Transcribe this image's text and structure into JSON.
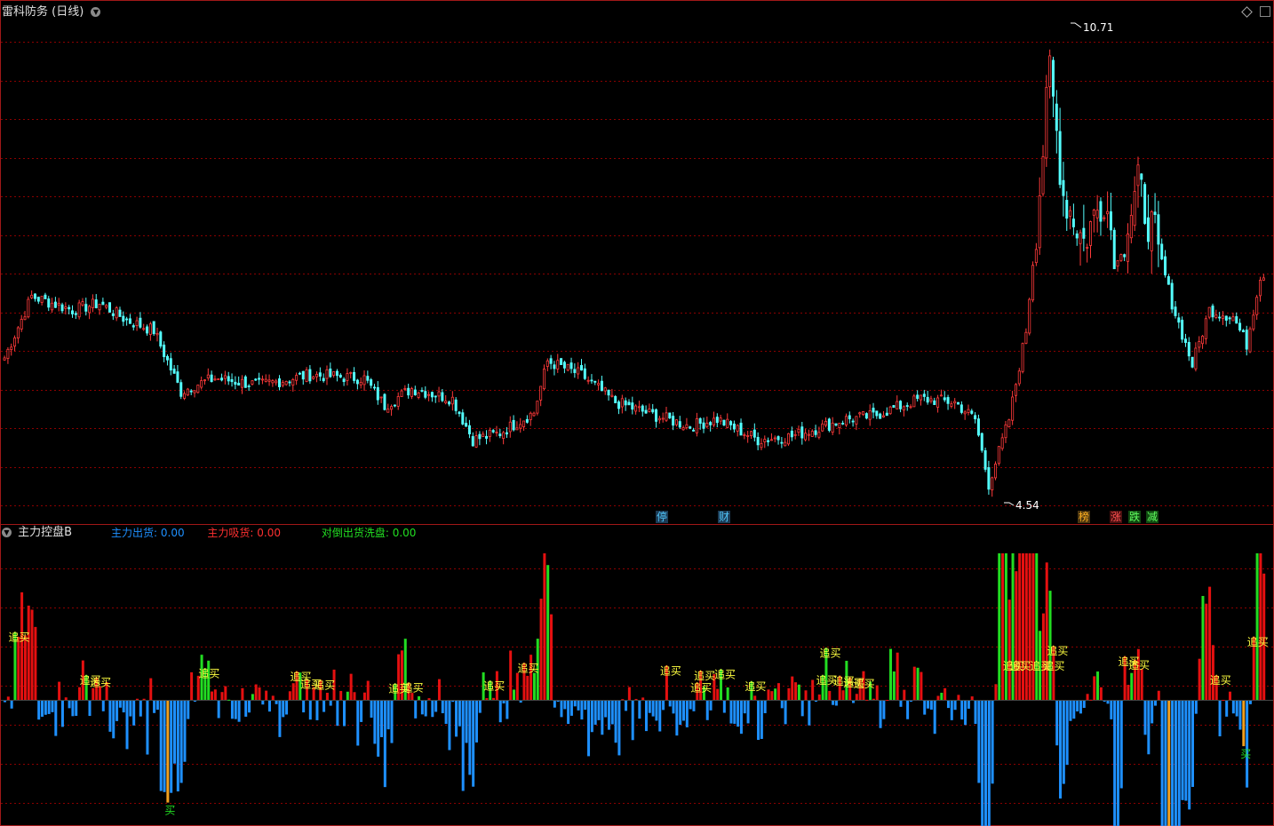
{
  "header": {
    "title": "雷科防务",
    "period": "(日线)"
  },
  "indicator": {
    "name": "主力控盘B",
    "items": [
      {
        "label": "主力出货:",
        "value": "0.00",
        "color": "#1e90ff"
      },
      {
        "label": "主力吸货:",
        "value": "0.00",
        "color": "#ff3030"
      },
      {
        "label": "对倒出货洗盘:",
        "value": "0.00",
        "color": "#22dd22"
      }
    ]
  },
  "events": [
    {
      "label": "停",
      "bg": "#1c3b55",
      "fg": "#4fc3f7"
    },
    {
      "label": "财",
      "bg": "#1c3b55",
      "fg": "#4fc3f7"
    },
    {
      "label": "榜",
      "bg": "#4a3510",
      "fg": "#ffb020"
    },
    {
      "label": "涨",
      "bg": "#4a1010",
      "fg": "#ff5050"
    },
    {
      "label": "跌",
      "bg": "#104a10",
      "fg": "#60ff60"
    },
    {
      "label": "减",
      "bg": "#104a10",
      "fg": "#60ff60"
    }
  ],
  "colors": {
    "up": "#ff3a3a",
    "down": "#54ffff",
    "grid": "#8b0000",
    "frame": "#a01818",
    "outflow": "#1e90ff",
    "inflow": "#e51010",
    "wash": "#22dd22",
    "buy_zone": "#f0a020",
    "signal_text": "#ffff40"
  },
  "chart_data": [
    {
      "type": "candlestick",
      "title": "雷科防务",
      "price_high_label": "10.71",
      "price_low_label": "4.54",
      "high": 10.71,
      "low": 4.54,
      "ylim": [
        4.2,
        11.3
      ],
      "anchors": [
        [
          0,
          6.4
        ],
        [
          8,
          7.3
        ],
        [
          20,
          7.1
        ],
        [
          28,
          7.2
        ],
        [
          36,
          6.95
        ],
        [
          44,
          6.8
        ],
        [
          52,
          5.9
        ],
        [
          56,
          6.0
        ],
        [
          62,
          6.1
        ],
        [
          75,
          6.0
        ],
        [
          90,
          6.15
        ],
        [
          106,
          6.1
        ],
        [
          112,
          5.7
        ],
        [
          120,
          5.95
        ],
        [
          132,
          5.8
        ],
        [
          138,
          5.2
        ],
        [
          146,
          5.3
        ],
        [
          156,
          5.6
        ],
        [
          160,
          6.35
        ],
        [
          170,
          6.15
        ],
        [
          180,
          5.75
        ],
        [
          192,
          5.55
        ],
        [
          202,
          5.4
        ],
        [
          210,
          5.5
        ],
        [
          222,
          5.2
        ],
        [
          232,
          5.25
        ],
        [
          248,
          5.5
        ],
        [
          256,
          5.55
        ],
        [
          270,
          5.8
        ],
        [
          280,
          5.75
        ],
        [
          286,
          5.5
        ],
        [
          290,
          4.55
        ],
        [
          296,
          5.5
        ],
        [
          301,
          6.8
        ],
        [
          304,
          8.3
        ],
        [
          308,
          10.6
        ],
        [
          312,
          8.8
        ],
        [
          318,
          8.1
        ],
        [
          324,
          8.8
        ],
        [
          328,
          7.8
        ],
        [
          334,
          8.9
        ],
        [
          340,
          8.0
        ],
        [
          344,
          7.2
        ],
        [
          350,
          6.3
        ],
        [
          355,
          7.1
        ],
        [
          362,
          7.0
        ],
        [
          366,
          6.6
        ],
        [
          370,
          7.6
        ]
      ],
      "count": 372,
      "indicator_name": "主力控盘B"
    },
    {
      "type": "bar",
      "name": "主力控盘B",
      "series": [
        "主力出货",
        "主力吸货",
        "对倒出货洗盘"
      ],
      "signals": [
        "追买",
        "买"
      ],
      "ylim": [
        -100,
        120
      ]
    }
  ]
}
